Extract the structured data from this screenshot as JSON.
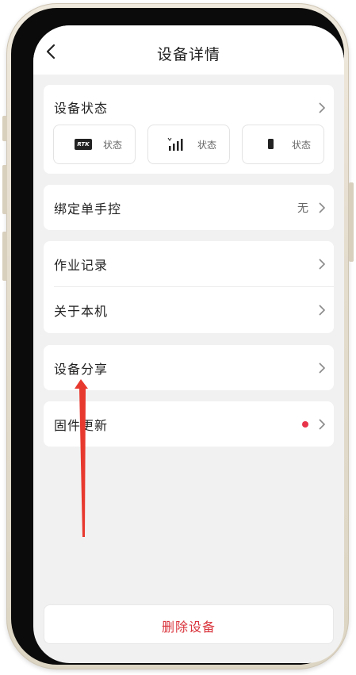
{
  "header": {
    "title": "设备详情"
  },
  "device_status": {
    "title": "设备状态",
    "tiles": [
      {
        "icon": "rtk-icon",
        "badge": "RTK",
        "label": "状态"
      },
      {
        "icon": "signal-icon",
        "label": "状态"
      },
      {
        "icon": "battery-icon",
        "label": "状态"
      }
    ]
  },
  "bind": {
    "label": "绑定单手控",
    "value": "无"
  },
  "records": {
    "work_log": "作业记录",
    "about": "关于本机"
  },
  "share": {
    "label": "设备分享"
  },
  "firmware": {
    "label": "固件更新"
  },
  "footer": {
    "delete_label": "删除设备"
  },
  "colors": {
    "accent": "#d9343c",
    "dot": "#e8344a",
    "annotation_arrow": "#e8392f"
  }
}
